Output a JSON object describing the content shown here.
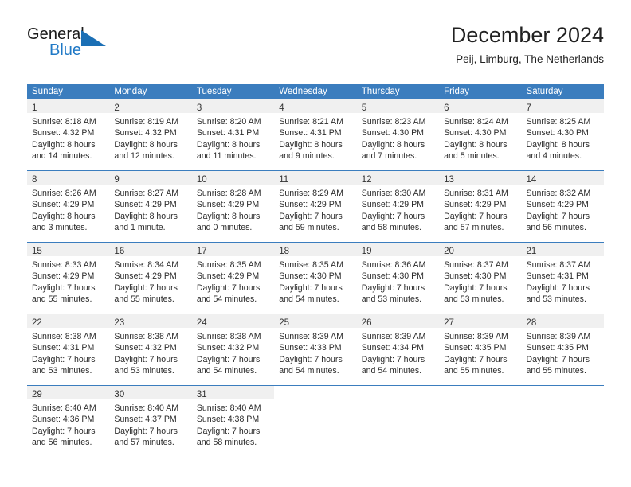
{
  "brand": {
    "name_top": "General",
    "name_bottom": "Blue",
    "triangle_icon": "triangle-logo-icon",
    "color_top": "#1b1b1b",
    "color_bottom": "#2079c6",
    "triangle_color": "#1b6fb5"
  },
  "header": {
    "title": "December 2024",
    "subtitle": "Peij, Limburg, The Netherlands"
  },
  "theme": {
    "header_bg": "#3b7dbe",
    "header_text": "#ffffff",
    "daynum_band_bg": "#f0f0f0",
    "row_divider": "#3b7dbe",
    "body_text": "#2b2b2b"
  },
  "calendar": {
    "weekday_headers": [
      "Sunday",
      "Monday",
      "Tuesday",
      "Wednesday",
      "Thursday",
      "Friday",
      "Saturday"
    ],
    "weeks": [
      [
        {
          "day": "1",
          "sunrise": "Sunrise: 8:18 AM",
          "sunset": "Sunset: 4:32 PM",
          "daylight_1": "Daylight: 8 hours",
          "daylight_2": "and 14 minutes."
        },
        {
          "day": "2",
          "sunrise": "Sunrise: 8:19 AM",
          "sunset": "Sunset: 4:32 PM",
          "daylight_1": "Daylight: 8 hours",
          "daylight_2": "and 12 minutes."
        },
        {
          "day": "3",
          "sunrise": "Sunrise: 8:20 AM",
          "sunset": "Sunset: 4:31 PM",
          "daylight_1": "Daylight: 8 hours",
          "daylight_2": "and 11 minutes."
        },
        {
          "day": "4",
          "sunrise": "Sunrise: 8:21 AM",
          "sunset": "Sunset: 4:31 PM",
          "daylight_1": "Daylight: 8 hours",
          "daylight_2": "and 9 minutes."
        },
        {
          "day": "5",
          "sunrise": "Sunrise: 8:23 AM",
          "sunset": "Sunset: 4:30 PM",
          "daylight_1": "Daylight: 8 hours",
          "daylight_2": "and 7 minutes."
        },
        {
          "day": "6",
          "sunrise": "Sunrise: 8:24 AM",
          "sunset": "Sunset: 4:30 PM",
          "daylight_1": "Daylight: 8 hours",
          "daylight_2": "and 5 minutes."
        },
        {
          "day": "7",
          "sunrise": "Sunrise: 8:25 AM",
          "sunset": "Sunset: 4:30 PM",
          "daylight_1": "Daylight: 8 hours",
          "daylight_2": "and 4 minutes."
        }
      ],
      [
        {
          "day": "8",
          "sunrise": "Sunrise: 8:26 AM",
          "sunset": "Sunset: 4:29 PM",
          "daylight_1": "Daylight: 8 hours",
          "daylight_2": "and 3 minutes."
        },
        {
          "day": "9",
          "sunrise": "Sunrise: 8:27 AM",
          "sunset": "Sunset: 4:29 PM",
          "daylight_1": "Daylight: 8 hours",
          "daylight_2": "and 1 minute."
        },
        {
          "day": "10",
          "sunrise": "Sunrise: 8:28 AM",
          "sunset": "Sunset: 4:29 PM",
          "daylight_1": "Daylight: 8 hours",
          "daylight_2": "and 0 minutes."
        },
        {
          "day": "11",
          "sunrise": "Sunrise: 8:29 AM",
          "sunset": "Sunset: 4:29 PM",
          "daylight_1": "Daylight: 7 hours",
          "daylight_2": "and 59 minutes."
        },
        {
          "day": "12",
          "sunrise": "Sunrise: 8:30 AM",
          "sunset": "Sunset: 4:29 PM",
          "daylight_1": "Daylight: 7 hours",
          "daylight_2": "and 58 minutes."
        },
        {
          "day": "13",
          "sunrise": "Sunrise: 8:31 AM",
          "sunset": "Sunset: 4:29 PM",
          "daylight_1": "Daylight: 7 hours",
          "daylight_2": "and 57 minutes."
        },
        {
          "day": "14",
          "sunrise": "Sunrise: 8:32 AM",
          "sunset": "Sunset: 4:29 PM",
          "daylight_1": "Daylight: 7 hours",
          "daylight_2": "and 56 minutes."
        }
      ],
      [
        {
          "day": "15",
          "sunrise": "Sunrise: 8:33 AM",
          "sunset": "Sunset: 4:29 PM",
          "daylight_1": "Daylight: 7 hours",
          "daylight_2": "and 55 minutes."
        },
        {
          "day": "16",
          "sunrise": "Sunrise: 8:34 AM",
          "sunset": "Sunset: 4:29 PM",
          "daylight_1": "Daylight: 7 hours",
          "daylight_2": "and 55 minutes."
        },
        {
          "day": "17",
          "sunrise": "Sunrise: 8:35 AM",
          "sunset": "Sunset: 4:29 PM",
          "daylight_1": "Daylight: 7 hours",
          "daylight_2": "and 54 minutes."
        },
        {
          "day": "18",
          "sunrise": "Sunrise: 8:35 AM",
          "sunset": "Sunset: 4:30 PM",
          "daylight_1": "Daylight: 7 hours",
          "daylight_2": "and 54 minutes."
        },
        {
          "day": "19",
          "sunrise": "Sunrise: 8:36 AM",
          "sunset": "Sunset: 4:30 PM",
          "daylight_1": "Daylight: 7 hours",
          "daylight_2": "and 53 minutes."
        },
        {
          "day": "20",
          "sunrise": "Sunrise: 8:37 AM",
          "sunset": "Sunset: 4:30 PM",
          "daylight_1": "Daylight: 7 hours",
          "daylight_2": "and 53 minutes."
        },
        {
          "day": "21",
          "sunrise": "Sunrise: 8:37 AM",
          "sunset": "Sunset: 4:31 PM",
          "daylight_1": "Daylight: 7 hours",
          "daylight_2": "and 53 minutes."
        }
      ],
      [
        {
          "day": "22",
          "sunrise": "Sunrise: 8:38 AM",
          "sunset": "Sunset: 4:31 PM",
          "daylight_1": "Daylight: 7 hours",
          "daylight_2": "and 53 minutes."
        },
        {
          "day": "23",
          "sunrise": "Sunrise: 8:38 AM",
          "sunset": "Sunset: 4:32 PM",
          "daylight_1": "Daylight: 7 hours",
          "daylight_2": "and 53 minutes."
        },
        {
          "day": "24",
          "sunrise": "Sunrise: 8:38 AM",
          "sunset": "Sunset: 4:32 PM",
          "daylight_1": "Daylight: 7 hours",
          "daylight_2": "and 54 minutes."
        },
        {
          "day": "25",
          "sunrise": "Sunrise: 8:39 AM",
          "sunset": "Sunset: 4:33 PM",
          "daylight_1": "Daylight: 7 hours",
          "daylight_2": "and 54 minutes."
        },
        {
          "day": "26",
          "sunrise": "Sunrise: 8:39 AM",
          "sunset": "Sunset: 4:34 PM",
          "daylight_1": "Daylight: 7 hours",
          "daylight_2": "and 54 minutes."
        },
        {
          "day": "27",
          "sunrise": "Sunrise: 8:39 AM",
          "sunset": "Sunset: 4:35 PM",
          "daylight_1": "Daylight: 7 hours",
          "daylight_2": "and 55 minutes."
        },
        {
          "day": "28",
          "sunrise": "Sunrise: 8:39 AM",
          "sunset": "Sunset: 4:35 PM",
          "daylight_1": "Daylight: 7 hours",
          "daylight_2": "and 55 minutes."
        }
      ],
      [
        {
          "day": "29",
          "sunrise": "Sunrise: 8:40 AM",
          "sunset": "Sunset: 4:36 PM",
          "daylight_1": "Daylight: 7 hours",
          "daylight_2": "and 56 minutes."
        },
        {
          "day": "30",
          "sunrise": "Sunrise: 8:40 AM",
          "sunset": "Sunset: 4:37 PM",
          "daylight_1": "Daylight: 7 hours",
          "daylight_2": "and 57 minutes."
        },
        {
          "day": "31",
          "sunrise": "Sunrise: 8:40 AM",
          "sunset": "Sunset: 4:38 PM",
          "daylight_1": "Daylight: 7 hours",
          "daylight_2": "and 58 minutes."
        },
        {
          "day": "",
          "sunrise": "",
          "sunset": "",
          "daylight_1": "",
          "daylight_2": ""
        },
        {
          "day": "",
          "sunrise": "",
          "sunset": "",
          "daylight_1": "",
          "daylight_2": ""
        },
        {
          "day": "",
          "sunrise": "",
          "sunset": "",
          "daylight_1": "",
          "daylight_2": ""
        },
        {
          "day": "",
          "sunrise": "",
          "sunset": "",
          "daylight_1": "",
          "daylight_2": ""
        }
      ]
    ]
  }
}
